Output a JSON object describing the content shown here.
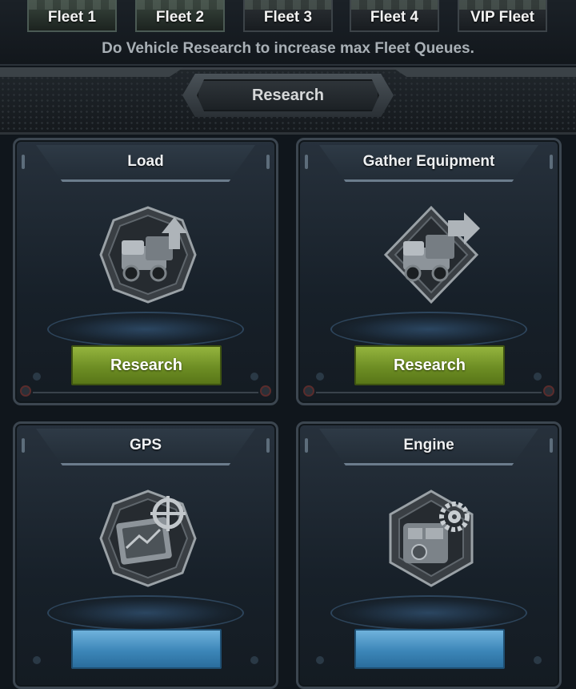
{
  "fleets": [
    {
      "label": "Fleet 1",
      "locked": false
    },
    {
      "label": "Fleet 2",
      "locked": false
    },
    {
      "label": "Fleet 3",
      "locked": true
    },
    {
      "label": "Fleet 4",
      "locked": true
    },
    {
      "label": "VIP Fleet",
      "locked": true
    }
  ],
  "hint": "Do Vehicle Research to increase max Fleet Queues.",
  "section_title": "Research",
  "cards": [
    {
      "title": "Load",
      "icon": "truck-load-icon",
      "button_label": "Research",
      "button_color": "#7e9e2c"
    },
    {
      "title": "Gather Equipment",
      "icon": "truck-gather-icon",
      "button_label": "Research",
      "button_color": "#7e9e2c"
    },
    {
      "title": "GPS",
      "icon": "gps-device-icon",
      "button_label": "",
      "button_color": "#3c86b8"
    },
    {
      "title": "Engine",
      "icon": "engine-gear-icon",
      "button_label": "",
      "button_color": "#3c86b8"
    }
  ],
  "colors": {
    "background": "#10161c",
    "research_button_green": "#7e9e2c",
    "button_blue": "#3c86b8"
  }
}
